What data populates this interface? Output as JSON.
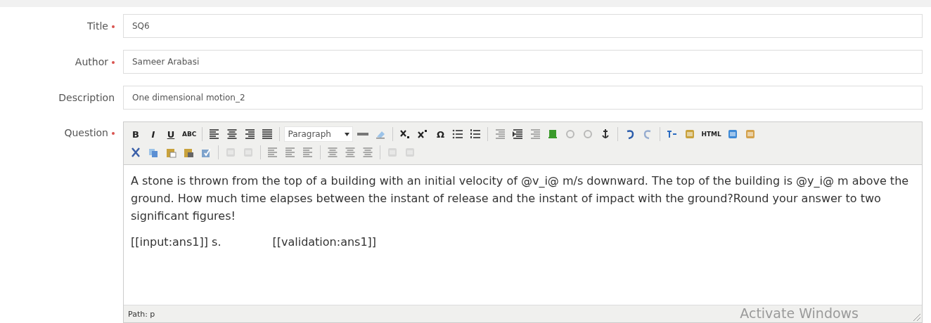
{
  "fields": [
    {
      "label": "Title",
      "required": true,
      "value": "SQ6"
    },
    {
      "label": "Author",
      "required": true,
      "value": "Sameer Arabasi"
    },
    {
      "label": "Description",
      "required": false,
      "value": "One dimensional motion_2"
    }
  ],
  "question": {
    "label": "Question",
    "required": true,
    "toolbar": [
      [
        {
          "kind": "text",
          "label": "B",
          "disabled": false
        },
        {
          "kind": "text",
          "label": "I",
          "disabled": false
        },
        {
          "kind": "text",
          "label": "U",
          "disabled": false
        },
        {
          "kind": "text",
          "label": "ABC",
          "disabled": false
        },
        {
          "kind": "sep"
        },
        {
          "kind": "button",
          "disabled": false
        },
        {
          "kind": "button",
          "disabled": false
        },
        {
          "kind": "button",
          "disabled": false
        },
        {
          "kind": "button",
          "disabled": false
        },
        {
          "kind": "sep"
        },
        {
          "kind": "select",
          "label": "Paragraph"
        },
        {
          "kind": "button",
          "disabled": false
        },
        {
          "kind": "button",
          "disabled": false
        },
        {
          "kind": "sep"
        },
        {
          "kind": "button",
          "disabled": false
        },
        {
          "kind": "button",
          "disabled": false
        },
        {
          "kind": "text",
          "label": "Ω",
          "disabled": false
        },
        {
          "kind": "button",
          "disabled": false
        },
        {
          "kind": "button",
          "disabled": false
        },
        {
          "kind": "sep"
        },
        {
          "kind": "button",
          "disabled": true
        },
        {
          "kind": "button",
          "disabled": false
        },
        {
          "kind": "button",
          "disabled": true
        },
        {
          "kind": "button",
          "disabled": false
        },
        {
          "kind": "button",
          "disabled": true
        },
        {
          "kind": "button",
          "disabled": true
        },
        {
          "kind": "button",
          "disabled": false
        },
        {
          "kind": "sep"
        },
        {
          "kind": "button",
          "disabled": false
        },
        {
          "kind": "button",
          "disabled": true
        },
        {
          "kind": "sep"
        },
        {
          "kind": "button",
          "disabled": false
        },
        {
          "kind": "button",
          "disabled": false
        },
        {
          "kind": "text",
          "label": "HTML",
          "disabled": false
        },
        {
          "kind": "button",
          "disabled": false
        },
        {
          "kind": "button",
          "disabled": false
        }
      ],
      [
        {
          "kind": "button",
          "disabled": false
        },
        {
          "kind": "button",
          "disabled": false
        },
        {
          "kind": "button",
          "disabled": false
        },
        {
          "kind": "button",
          "disabled": false
        },
        {
          "kind": "button",
          "disabled": false
        },
        {
          "kind": "sep"
        },
        {
          "kind": "button",
          "disabled": true
        },
        {
          "kind": "button",
          "disabled": true
        },
        {
          "kind": "sep"
        },
        {
          "kind": "button",
          "disabled": true
        },
        {
          "kind": "button",
          "disabled": true
        },
        {
          "kind": "button",
          "disabled": true
        },
        {
          "kind": "sep"
        },
        {
          "kind": "button",
          "disabled": true
        },
        {
          "kind": "button",
          "disabled": true
        },
        {
          "kind": "button",
          "disabled": true
        },
        {
          "kind": "sep"
        },
        {
          "kind": "button",
          "disabled": true
        },
        {
          "kind": "button",
          "disabled": true
        }
      ]
    ],
    "paragraphs": [
      "A stone is thrown from the top of a building with an initial velocity of @v_i@ m/s downward. The top of the building is @y_i@ m above the ground. How much time elapses between the instant of release and the instant of impact with the ground?Round your answer to two significant figures!"
    ],
    "placeholders": [
      "[[input:ans1]] s.",
      "[[validation:ans1]]"
    ],
    "path": "Path: p"
  },
  "os_notice": "Activate Windows"
}
